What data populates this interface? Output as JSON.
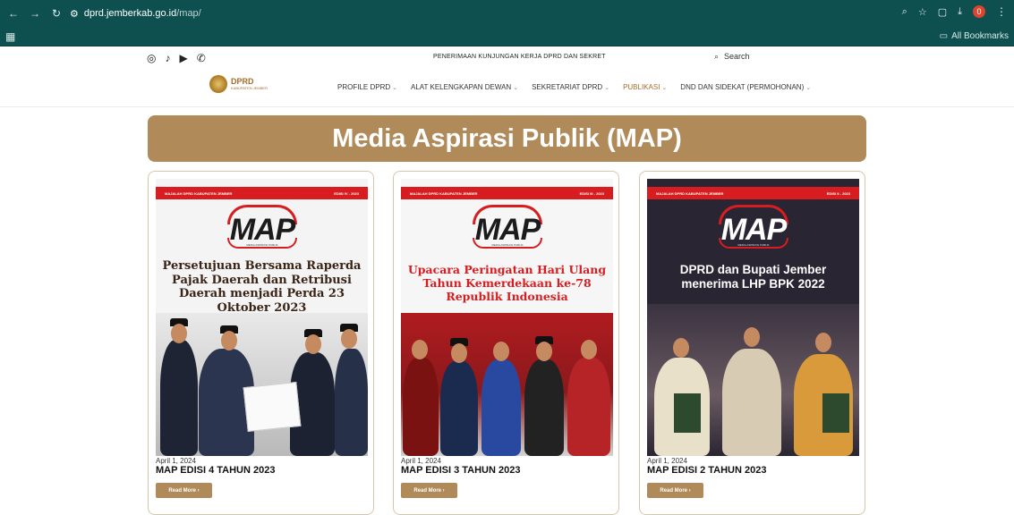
{
  "browser": {
    "url_host": "dprd.jemberkab.go.id",
    "url_path": "/map/",
    "bookmarks_label": "All Bookmarks",
    "ext_badge": "0"
  },
  "topbar": {
    "ticker": "PENERIMAAN KUNJUNGAN KERJA DPRD DAN SEKRET",
    "search_placeholder": "Search"
  },
  "logo": {
    "title": "DPRD",
    "subtitle": "KABUPATEN JEMBER"
  },
  "menu": [
    {
      "label": "PROFILE DPRD",
      "active": false
    },
    {
      "label": "ALAT KELENGKAPAN DEWAN",
      "active": false
    },
    {
      "label": "SEKRETARIAT DPRD",
      "active": false
    },
    {
      "label": "PUBLIKASI",
      "active": true
    },
    {
      "label": "DND DAN SIDEKAT (PERMOHONAN)",
      "active": false
    }
  ],
  "banner": {
    "title": "Media Aspirasi Publik (MAP)"
  },
  "cards": [
    {
      "cover_bar_left": "MAJALAH DPRD KABUPATEN JEMBER",
      "cover_bar_right": "EDISI IV - 2023",
      "map_word": "MAP",
      "map_sub": "MEDIA ASPIRASI PUBLIK",
      "headline": "Persetujuan Bersama Raperda Pajak Daerah dan Retribusi Daerah menjadi Perda 23 Oktober 2023",
      "date": "April 1, 2024",
      "title": "MAP EDISI 4 TAHUN 2023",
      "button": "Read More ›"
    },
    {
      "cover_bar_left": "MAJALAH DPRD KABUPATEN JEMBER",
      "cover_bar_right": "EDISI III - 2023",
      "map_word": "MAP",
      "map_sub": "MEDIA ASPIRASI PUBLIK",
      "headline": "Upacara Peringatan Hari Ulang Tahun Kemerdekaan ke-78 Republik Indonesia",
      "date": "April 1, 2024",
      "title": "MAP EDISI 3 TAHUN 2023",
      "button": "Read More ›"
    },
    {
      "cover_bar_left": "MAJALAH DPRD KABUPATEN JEMBER",
      "cover_bar_right": "EDISI II - 2023",
      "map_word": "MAP",
      "map_sub": "MEDIA ASPIRASI PUBLIK",
      "headline": "DPRD dan Bupati Jember menerima LHP BPK 2022",
      "date": "April 1, 2024",
      "title": "MAP EDISI 2 TAHUN 2023",
      "button": "Read More ›"
    }
  ],
  "colors": {
    "chrome": "#0e4f4f",
    "accent": "#b08a58",
    "red": "#d81d20"
  }
}
